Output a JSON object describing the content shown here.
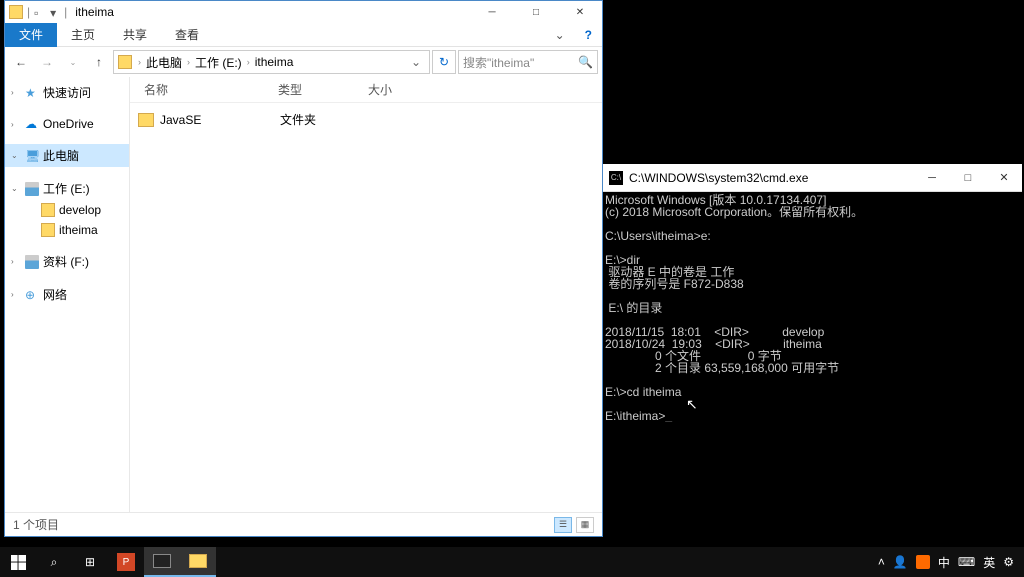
{
  "explorer": {
    "title": "itheima",
    "ribbon": {
      "file": "文件",
      "home": "主页",
      "share": "共享",
      "view": "查看"
    },
    "breadcrumb": [
      "此电脑",
      "工作 (E:)",
      "itheima"
    ],
    "search_placeholder": "搜索\"itheima\"",
    "nav": {
      "quick": "快速访问",
      "onedrive": "OneDrive",
      "pc": "此电脑",
      "work": "工作 (E:)",
      "develop": "develop",
      "itheima": "itheima",
      "data": "资料 (F:)",
      "network": "网络"
    },
    "headers": {
      "name": "名称",
      "type": "类型",
      "size": "大小"
    },
    "files": {
      "JavaSE": "JavaSE",
      "folder_type": "文件夹"
    },
    "status": "1 个项目"
  },
  "cmd": {
    "title": "C:\\WINDOWS\\system32\\cmd.exe",
    "lines": [
      "Microsoft Windows [版本 10.0.17134.407]",
      "(c) 2018 Microsoft Corporation。保留所有权利。",
      "",
      "C:\\Users\\itheima>e:",
      "",
      "E:\\>dir",
      " 驱动器 E 中的卷是 工作",
      " 卷的序列号是 F872-D838",
      "",
      " E:\\ 的目录",
      "",
      "2018/11/15  18:01    <DIR>          develop",
      "2018/10/24  19:03    <DIR>          itheima",
      "               0 个文件              0 字节",
      "               2 个目录 63,559,168,000 可用字节",
      "",
      "E:\\>cd itheima",
      "",
      "E:\\itheima>_"
    ]
  },
  "taskbar": {
    "ime": "中",
    "lang": "英"
  }
}
